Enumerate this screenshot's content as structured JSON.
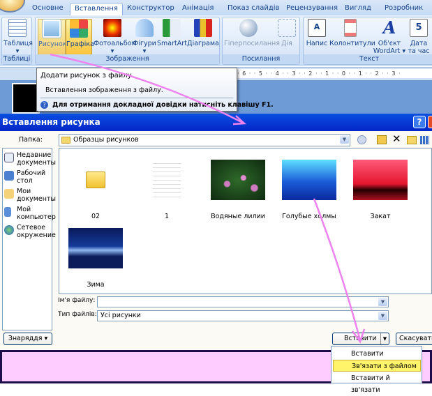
{
  "ribbon": {
    "tabs": [
      "Основне",
      "Вставлення",
      "Конструктор",
      "Анімація",
      "Показ слайдів",
      "Рецензування",
      "Вигляд",
      "Розробник"
    ],
    "active_tab": "Вставлення",
    "groups": {
      "tables": "Таблиці",
      "images": "Зображення",
      "links": "Посилання",
      "text": "Текст"
    },
    "buttons": {
      "table": "Таблиця",
      "picture": "Рисунок",
      "clipart": "Графіка",
      "photoalbum": "Фотоальбом",
      "shapes": "Фігури",
      "smartart": "SmartArt",
      "chart": "Діаграма",
      "hyperlink": "Гіперпосилання",
      "action": "Дія",
      "textbox": "Напис",
      "headerfooter": "Колонтитули",
      "wordart_1": "Об'єкт",
      "wordart_2": "WordArt",
      "datetime_1": "Дата",
      "datetime_2": "та час"
    }
  },
  "ruler": "· 6 · · 5 · · 4 · · 3 · · 2 · · 1 · · 0 · · 1 · · 2 · · 3 ·",
  "tooltip": {
    "title": "Додати рисунок з файлу",
    "description": "Вставлення зображення з файлу.",
    "help": "Для отримання докладної довідки натисніть клавішу F1."
  },
  "dialog": {
    "title": "Вставлення рисунка",
    "folder_label": "Папка:",
    "folder_value": "Образцы рисунков",
    "places": [
      "Недавние документы",
      "Рабочий стол",
      "Мои документы",
      "Мой компьютер",
      "Сетевое окружение"
    ],
    "files": [
      "02",
      "1",
      "Водяные лилии",
      "Голубые холмы",
      "Закат",
      "Зима"
    ],
    "filename_label": "Ім'я файлу:",
    "filename_value": "",
    "filetype_label": "Тип файлів:",
    "filetype_value": "Усі рисунки",
    "tools_button": "Знаряддя",
    "insert_button": "Вставити",
    "cancel_button": "Скасувати",
    "insert_menu": [
      "Вставити",
      "Зв'язати з файлом",
      "Вставити й зв'язати"
    ]
  },
  "colors": {
    "title_bar": "#0a3fd8",
    "highlight": "#fff46a",
    "arrow": "#ee82ee",
    "pink": "#ffccff"
  }
}
